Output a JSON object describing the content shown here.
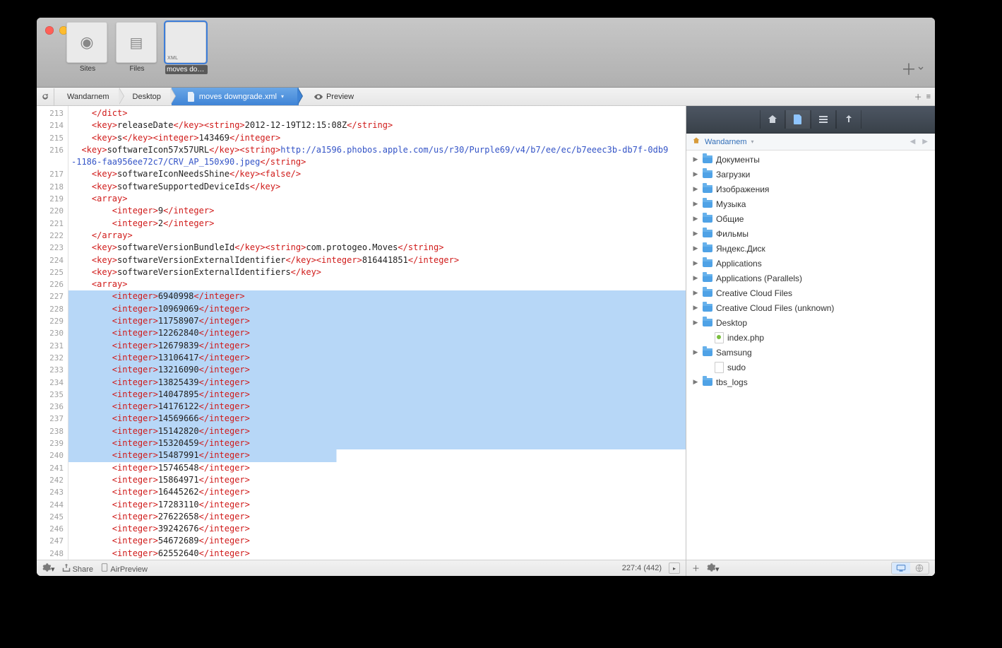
{
  "toolbar": {
    "thumbs": [
      {
        "label": "Sites",
        "type": "globe"
      },
      {
        "label": "Files",
        "type": "files"
      },
      {
        "label": "moves downgrade",
        "type": "xml",
        "badge": "XML"
      }
    ]
  },
  "path": {
    "crumbs": [
      "Wandarnem",
      "Desktop"
    ],
    "file": "moves downgrade.xml",
    "preview": "Preview"
  },
  "editor": {
    "startLine": 213,
    "selection": {
      "fromLine": 227,
      "toLine": 240,
      "lastLineChars": 44
    },
    "lines": [
      {
        "parts": [
          {
            "c": "tag",
            "t": "</dict>"
          }
        ],
        "indent": 2,
        "n": 213,
        "partial": true
      },
      {
        "parts": [
          {
            "c": "tag",
            "t": "<key>"
          },
          {
            "c": "txt",
            "t": "releaseDate"
          },
          {
            "c": "tag",
            "t": "</key><string>"
          },
          {
            "c": "txt",
            "t": "2012-12-19T12:15:08Z"
          },
          {
            "c": "tag",
            "t": "</string>"
          }
        ],
        "indent": 2,
        "n": 214
      },
      {
        "parts": [
          {
            "c": "tag",
            "t": "<key>"
          },
          {
            "c": "txt",
            "t": "s"
          },
          {
            "c": "tag",
            "t": "</key><integer>"
          },
          {
            "c": "txt",
            "t": "143469"
          },
          {
            "c": "tag",
            "t": "</integer>"
          }
        ],
        "indent": 2,
        "n": 215
      },
      {
        "parts": [
          {
            "c": "tag",
            "t": "<key>"
          },
          {
            "c": "txt",
            "t": "softwareIcon57x57URL"
          },
          {
            "c": "tag",
            "t": "</key><string>"
          },
          {
            "c": "link",
            "t": "http://a1596.phobos.apple.com/us/r30/Purple69/v4/b7/ee/ec/b7eeec3b-db7f-0db9-1186-faa956ee72c7/CRV_AP_150x90.jpeg"
          },
          {
            "c": "tag",
            "t": "</string>"
          }
        ],
        "indent": 1,
        "wrap": true,
        "n": 216
      },
      {
        "parts": [
          {
            "c": "tag",
            "t": "<key>"
          },
          {
            "c": "txt",
            "t": "softwareIconNeedsShine"
          },
          {
            "c": "tag",
            "t": "</key><false/>"
          }
        ],
        "indent": 2,
        "n": 217
      },
      {
        "parts": [
          {
            "c": "tag",
            "t": "<key>"
          },
          {
            "c": "txt",
            "t": "softwareSupportedDeviceIds"
          },
          {
            "c": "tag",
            "t": "</key>"
          }
        ],
        "indent": 2,
        "n": 218
      },
      {
        "parts": [
          {
            "c": "tag",
            "t": "<array>"
          }
        ],
        "indent": 2,
        "n": 219
      },
      {
        "parts": [
          {
            "c": "tag",
            "t": "<integer>"
          },
          {
            "c": "txt",
            "t": "9"
          },
          {
            "c": "tag",
            "t": "</integer>"
          }
        ],
        "indent": 4,
        "n": 220
      },
      {
        "parts": [
          {
            "c": "tag",
            "t": "<integer>"
          },
          {
            "c": "txt",
            "t": "2"
          },
          {
            "c": "tag",
            "t": "</integer>"
          }
        ],
        "indent": 4,
        "n": 221
      },
      {
        "parts": [
          {
            "c": "tag",
            "t": "</array>"
          }
        ],
        "indent": 2,
        "n": 222
      },
      {
        "parts": [
          {
            "c": "tag",
            "t": "<key>"
          },
          {
            "c": "txt",
            "t": "softwareVersionBundleId"
          },
          {
            "c": "tag",
            "t": "</key><string>"
          },
          {
            "c": "txt",
            "t": "com.protogeo.Moves"
          },
          {
            "c": "tag",
            "t": "</string>"
          }
        ],
        "indent": 2,
        "n": 223
      },
      {
        "parts": [
          {
            "c": "tag",
            "t": "<key>"
          },
          {
            "c": "txt",
            "t": "softwareVersionExternalIdentifier"
          },
          {
            "c": "tag",
            "t": "</key><integer>"
          },
          {
            "c": "txt",
            "t": "816441851"
          },
          {
            "c": "tag",
            "t": "</integer>"
          }
        ],
        "indent": 2,
        "n": 224
      },
      {
        "parts": [
          {
            "c": "tag",
            "t": "<key>"
          },
          {
            "c": "txt",
            "t": "softwareVersionExternalIdentifiers"
          },
          {
            "c": "tag",
            "t": "</key>"
          }
        ],
        "indent": 2,
        "n": 225
      },
      {
        "parts": [
          {
            "c": "tag",
            "t": "<array>"
          }
        ],
        "indent": 2,
        "n": 226
      },
      {
        "parts": [
          {
            "c": "tag",
            "t": "<integer>"
          },
          {
            "c": "txt",
            "t": "6940998"
          },
          {
            "c": "tag",
            "t": "</integer>"
          }
        ],
        "indent": 4,
        "n": 227
      },
      {
        "parts": [
          {
            "c": "tag",
            "t": "<integer>"
          },
          {
            "c": "txt",
            "t": "10969069"
          },
          {
            "c": "tag",
            "t": "</integer>"
          }
        ],
        "indent": 4,
        "n": 228
      },
      {
        "parts": [
          {
            "c": "tag",
            "t": "<integer>"
          },
          {
            "c": "txt",
            "t": "11758907"
          },
          {
            "c": "tag",
            "t": "</integer>"
          }
        ],
        "indent": 4,
        "n": 229
      },
      {
        "parts": [
          {
            "c": "tag",
            "t": "<integer>"
          },
          {
            "c": "txt",
            "t": "12262840"
          },
          {
            "c": "tag",
            "t": "</integer>"
          }
        ],
        "indent": 4,
        "n": 230
      },
      {
        "parts": [
          {
            "c": "tag",
            "t": "<integer>"
          },
          {
            "c": "txt",
            "t": "12679839"
          },
          {
            "c": "tag",
            "t": "</integer>"
          }
        ],
        "indent": 4,
        "n": 231
      },
      {
        "parts": [
          {
            "c": "tag",
            "t": "<integer>"
          },
          {
            "c": "txt",
            "t": "13106417"
          },
          {
            "c": "tag",
            "t": "</integer>"
          }
        ],
        "indent": 4,
        "n": 232
      },
      {
        "parts": [
          {
            "c": "tag",
            "t": "<integer>"
          },
          {
            "c": "txt",
            "t": "13216090"
          },
          {
            "c": "tag",
            "t": "</integer>"
          }
        ],
        "indent": 4,
        "n": 233
      },
      {
        "parts": [
          {
            "c": "tag",
            "t": "<integer>"
          },
          {
            "c": "txt",
            "t": "13825439"
          },
          {
            "c": "tag",
            "t": "</integer>"
          }
        ],
        "indent": 4,
        "n": 234
      },
      {
        "parts": [
          {
            "c": "tag",
            "t": "<integer>"
          },
          {
            "c": "txt",
            "t": "14047895"
          },
          {
            "c": "tag",
            "t": "</integer>"
          }
        ],
        "indent": 4,
        "n": 235
      },
      {
        "parts": [
          {
            "c": "tag",
            "t": "<integer>"
          },
          {
            "c": "txt",
            "t": "14176122"
          },
          {
            "c": "tag",
            "t": "</integer>"
          }
        ],
        "indent": 4,
        "n": 236
      },
      {
        "parts": [
          {
            "c": "tag",
            "t": "<integer>"
          },
          {
            "c": "txt",
            "t": "14569666"
          },
          {
            "c": "tag",
            "t": "</integer>"
          }
        ],
        "indent": 4,
        "n": 237
      },
      {
        "parts": [
          {
            "c": "tag",
            "t": "<integer>"
          },
          {
            "c": "txt",
            "t": "15142820"
          },
          {
            "c": "tag",
            "t": "</integer>"
          }
        ],
        "indent": 4,
        "n": 238
      },
      {
        "parts": [
          {
            "c": "tag",
            "t": "<integer>"
          },
          {
            "c": "txt",
            "t": "15320459"
          },
          {
            "c": "tag",
            "t": "</integer>"
          }
        ],
        "indent": 4,
        "n": 239
      },
      {
        "parts": [
          {
            "c": "tag",
            "t": "<integer>"
          },
          {
            "c": "txt",
            "t": "15487991"
          },
          {
            "c": "tag",
            "t": "</integer>"
          }
        ],
        "indent": 4,
        "n": 240
      },
      {
        "parts": [
          {
            "c": "tag",
            "t": "<integer>"
          },
          {
            "c": "txt",
            "t": "15746548"
          },
          {
            "c": "tag",
            "t": "</integer>"
          }
        ],
        "indent": 4,
        "n": 241
      },
      {
        "parts": [
          {
            "c": "tag",
            "t": "<integer>"
          },
          {
            "c": "txt",
            "t": "15864971"
          },
          {
            "c": "tag",
            "t": "</integer>"
          }
        ],
        "indent": 4,
        "n": 242
      },
      {
        "parts": [
          {
            "c": "tag",
            "t": "<integer>"
          },
          {
            "c": "txt",
            "t": "16445262"
          },
          {
            "c": "tag",
            "t": "</integer>"
          }
        ],
        "indent": 4,
        "n": 243
      },
      {
        "parts": [
          {
            "c": "tag",
            "t": "<integer>"
          },
          {
            "c": "txt",
            "t": "17283110"
          },
          {
            "c": "tag",
            "t": "</integer>"
          }
        ],
        "indent": 4,
        "n": 244
      },
      {
        "parts": [
          {
            "c": "tag",
            "t": "<integer>"
          },
          {
            "c": "txt",
            "t": "27622658"
          },
          {
            "c": "tag",
            "t": "</integer>"
          }
        ],
        "indent": 4,
        "n": 245
      },
      {
        "parts": [
          {
            "c": "tag",
            "t": "<integer>"
          },
          {
            "c": "txt",
            "t": "39242676"
          },
          {
            "c": "tag",
            "t": "</integer>"
          }
        ],
        "indent": 4,
        "n": 246
      },
      {
        "parts": [
          {
            "c": "tag",
            "t": "<integer>"
          },
          {
            "c": "txt",
            "t": "54672689"
          },
          {
            "c": "tag",
            "t": "</integer>"
          }
        ],
        "indent": 4,
        "n": 247
      },
      {
        "parts": [
          {
            "c": "tag",
            "t": "<integer>"
          },
          {
            "c": "txt",
            "t": "62552640"
          },
          {
            "c": "tag",
            "t": "</integer>"
          }
        ],
        "indent": 4,
        "n": 248
      }
    ]
  },
  "status": {
    "share": "Share",
    "airpreview": "AirPreview",
    "cursor": "227:4 (442)"
  },
  "inspector": {
    "root": "Wandarnem",
    "items": [
      {
        "name": "Документы",
        "type": "folder",
        "disc": true
      },
      {
        "name": "Загрузки",
        "type": "folder",
        "disc": true
      },
      {
        "name": "Изображения",
        "type": "folder",
        "disc": true
      },
      {
        "name": "Музыка",
        "type": "folder",
        "disc": true
      },
      {
        "name": "Общие",
        "type": "folder",
        "disc": true
      },
      {
        "name": "Фильмы",
        "type": "folder",
        "disc": true
      },
      {
        "name": "Яндекс.Диск",
        "type": "folder",
        "disc": true
      },
      {
        "name": "Applications",
        "type": "folder",
        "disc": true
      },
      {
        "name": "Applications (Parallels)",
        "type": "folder",
        "disc": true
      },
      {
        "name": "Creative Cloud Files",
        "type": "folder",
        "disc": true
      },
      {
        "name": "Creative Cloud Files (unknown)",
        "type": "folder",
        "disc": true
      },
      {
        "name": "Desktop",
        "type": "folder",
        "disc": true
      },
      {
        "name": "index.php",
        "type": "php",
        "disc": false,
        "indent": 1
      },
      {
        "name": "Samsung",
        "type": "folder",
        "disc": true
      },
      {
        "name": "sudo",
        "type": "file",
        "disc": false,
        "indent": 1
      },
      {
        "name": "tbs_logs",
        "type": "folder",
        "disc": true
      }
    ]
  }
}
